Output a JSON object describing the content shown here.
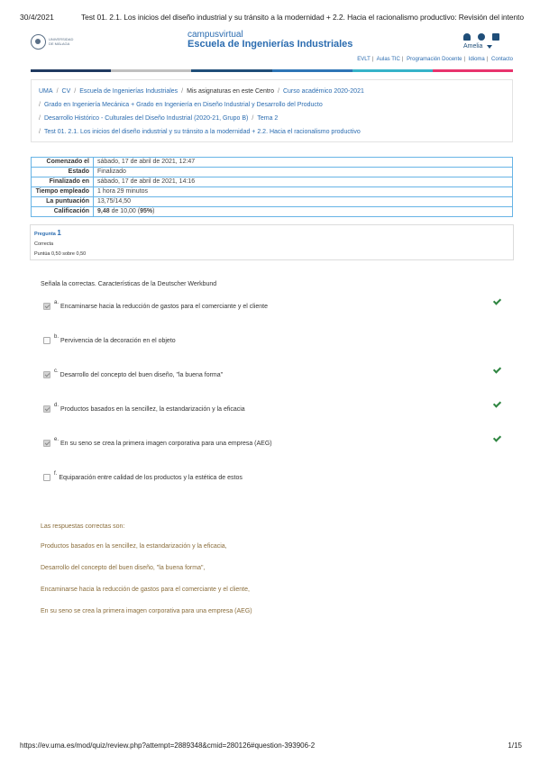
{
  "print": {
    "date": "30/4/2021",
    "title": "Test 01. 2.1. Los inicios del diseño industrial y su tránsito a la modernidad + 2.2. Hacia el racionalismo productivo: Revisión del intento",
    "url": "https://ev.uma.es/mod/quiz/review.php?attempt=2889348&cmid=280126#question-393906-2",
    "page": "1/15"
  },
  "logo": {
    "text_line1": "UNIVERSIDAD",
    "text_line2": "DE MÁLAGA"
  },
  "brand": {
    "campus": "campusvirtual",
    "school": "Escuela de Ingenierías Industriales"
  },
  "user": {
    "name": "Amelia"
  },
  "top_links": [
    "EVLT",
    "Aulas TIC",
    "Programación Docente",
    "Idioma",
    "Contacto"
  ],
  "color_bar": [
    "#1f3a60",
    "#c0c0c0",
    "#1f4e79",
    "#2e75b6",
    "#36b3c9",
    "#e8336d"
  ],
  "breadcrumb": {
    "row1": [
      "UMA",
      "CV",
      "Escuela de Ingenierías Industriales",
      "Mis asignaturas en este Centro",
      "Curso académico 2020-2021"
    ],
    "row2": [
      "Grado en Ingeniería Mecánica + Grado en Ingeniería en Diseño Industrial y Desarrollo del Producto"
    ],
    "row3": [
      "Desarrollo Histórico - Culturales del Diseño Industrial (2020-21, Grupo B)",
      "Tema 2"
    ],
    "row4": [
      "Test 01. 2.1. Los inicios del diseño industrial y su tránsito a la modernidad + 2.2. Hacia el racionalismo productivo"
    ]
  },
  "summary": {
    "started_label": "Comenzado el",
    "started_value": "sábado, 17 de abril de 2021, 12:47",
    "state_label": "Estado",
    "state_value": "Finalizado",
    "finished_label": "Finalizado en",
    "finished_value": "sábado, 17 de abril de 2021, 14:16",
    "time_label": "Tiempo empleado",
    "time_value": "1 hora 29 minutos",
    "score_label": "La puntuación",
    "score_value": "13,75/14,50",
    "grade_label": "Calificación",
    "grade_value_bold": "9,48",
    "grade_value_rest": " de 10,00 (",
    "grade_pct": "95%",
    "grade_close": ")"
  },
  "question": {
    "label": "Pregunta",
    "number": "1",
    "status": "Correcta",
    "points": "Puntúa 0,50 sobre 0,50",
    "text": "Señala la correctas. Características de la Deutscher Werkbund",
    "answers": [
      {
        "letter": "a.",
        "text": "Encaminarse hacia la reducción de gastos para el comerciante y el  cliente",
        "checked": true,
        "correct": true
      },
      {
        "letter": "b.",
        "text": "Pervivencia de la decoración en el objeto",
        "checked": false,
        "correct": false
      },
      {
        "letter": "c.",
        "text": "Desarrollo del concepto del buen diseño, \"la buena forma\"",
        "checked": true,
        "correct": true
      },
      {
        "letter": "d.",
        "text": "Productos basados en la sencillez, la estandarización y la eficacia",
        "checked": true,
        "correct": true
      },
      {
        "letter": "e.",
        "text": "En su seno se crea la primera imagen corporativa para una empresa (AEG)",
        "checked": true,
        "correct": true
      },
      {
        "letter": "f.",
        "text": "Equiparación entre calidad de los productos y la estética de estos",
        "checked": false,
        "correct": false
      }
    ]
  },
  "feedback": {
    "heading": "Las respuestas correctas son:",
    "lines": [
      "Productos basados en la sencillez, la estandarización y la eficacia,",
      "Desarrollo del concepto del buen diseño, \"la buena forma\",",
      "Encaminarse hacia la reducción de gastos para el comerciante y el  cliente,",
      "En su seno se crea la primera imagen corporativa para una empresa (AEG)"
    ]
  }
}
